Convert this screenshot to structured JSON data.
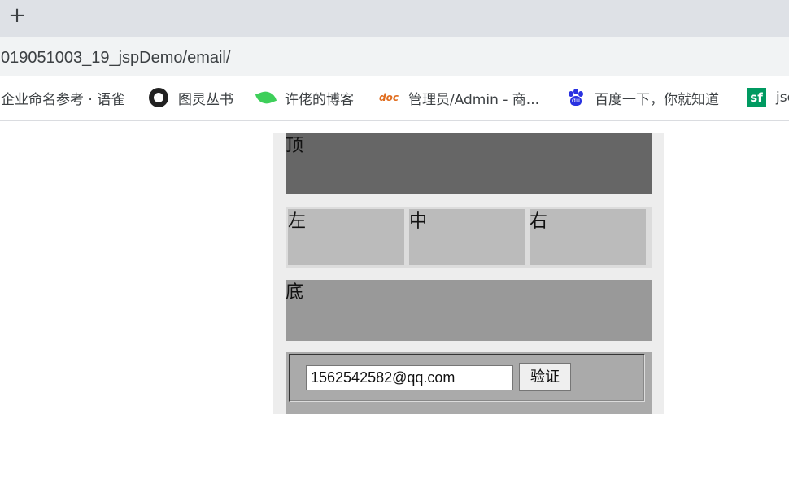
{
  "browser": {
    "new_tab_symbol": "+",
    "url": "019051003_19_jspDemo/email/",
    "bookmarks": [
      {
        "label": "企业命名参考 · 语雀",
        "icon": "none"
      },
      {
        "label": "图灵丛书",
        "icon": "github-icon"
      },
      {
        "label": "许佬的博客",
        "icon": "leaf-icon"
      },
      {
        "label": "管理员/Admin - 商...",
        "icon": "doc-icon",
        "icon_text": "doc"
      },
      {
        "label": "百度一下，你就知道",
        "icon": "baidu-icon",
        "icon_text": "du"
      },
      {
        "label": "jsc",
        "icon": "sf-icon",
        "icon_text": "sf"
      }
    ]
  },
  "page": {
    "top_label": "顶",
    "left_label": "左",
    "center_label": "中",
    "right_label": "右",
    "bottom_label": "底",
    "email_value": "1562542582@qq.com",
    "verify_label": "验证"
  },
  "colors": {
    "top": "#666666",
    "middle_row": "#dcdcdc",
    "columns": "#bbbbbb",
    "bottom": "#999999",
    "form_area": "#aaaaaa",
    "container": "#ededed"
  }
}
